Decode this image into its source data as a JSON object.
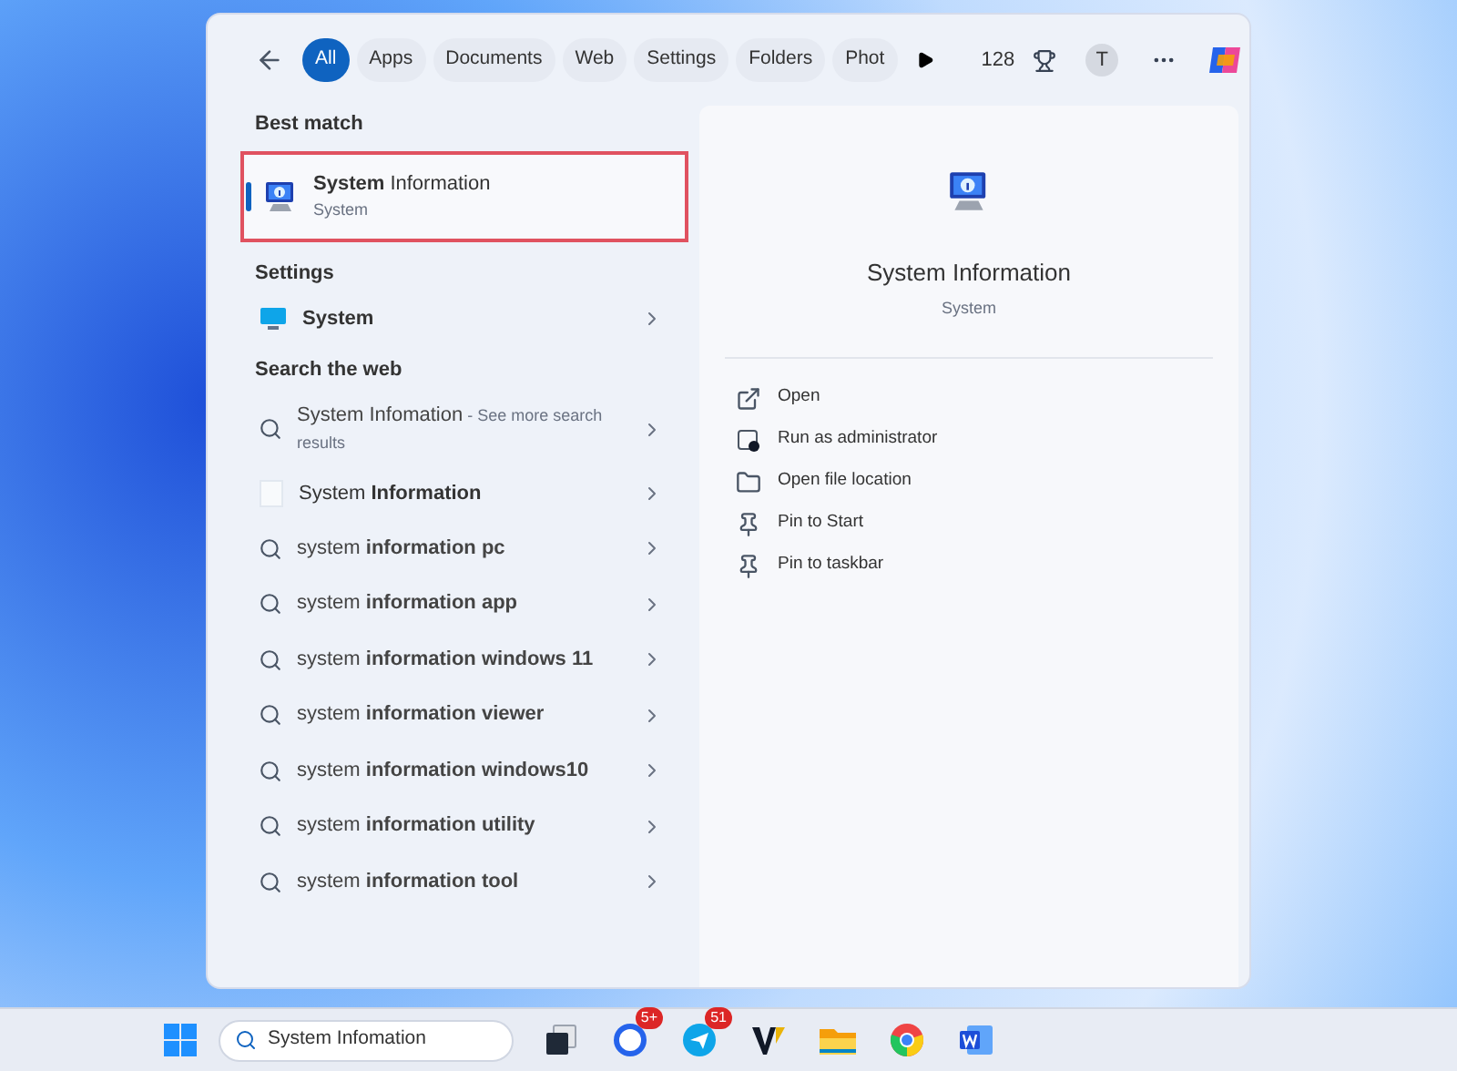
{
  "filters": [
    {
      "label": "All",
      "selected": true
    },
    {
      "label": "Apps",
      "selected": false
    },
    {
      "label": "Documents",
      "selected": false
    },
    {
      "label": "Web",
      "selected": false
    },
    {
      "label": "Settings",
      "selected": false
    },
    {
      "label": "Folders",
      "selected": false
    },
    {
      "label": "Phot",
      "selected": false
    }
  ],
  "points": "128",
  "avatar_letter": "T",
  "best_match": {
    "heading": "Best match",
    "title": "**System** Information",
    "subtitle": "System",
    "selected": true
  },
  "settings": {
    "heading": "Settings",
    "items": [
      {
        "label": "System"
      }
    ]
  },
  "web": {
    "heading": "Search the web",
    "items": [
      {
        "kind": "search",
        "text": "System Infomation",
        "hint": "- See more search results"
      },
      {
        "kind": "app",
        "text": "System **Information**"
      },
      {
        "kind": "search",
        "text": "system **information pc**"
      },
      {
        "kind": "search",
        "text": "system **information app**"
      },
      {
        "kind": "search",
        "text": "system **information windows 11**"
      },
      {
        "kind": "search",
        "text": "system **information viewer**"
      },
      {
        "kind": "search",
        "text": "system **information windows10**"
      },
      {
        "kind": "search",
        "text": "system **information utility**"
      },
      {
        "kind": "search",
        "text": "system **information tool**"
      }
    ]
  },
  "preview": {
    "title": "System Information",
    "subtitle": "System",
    "actions": [
      {
        "kind": "open",
        "label": "Open"
      },
      {
        "kind": "admin",
        "label": "Run as administrator"
      },
      {
        "kind": "folder",
        "label": "Open file location"
      },
      {
        "kind": "pin",
        "label": "Pin to Start"
      },
      {
        "kind": "pin",
        "label": "Pin to taskbar"
      }
    ]
  },
  "taskbar": {
    "search_value": "System Infomation",
    "apps": [
      {
        "kind": "taskview"
      },
      {
        "kind": "chat",
        "badge": "5+"
      },
      {
        "kind": "messenger",
        "badge": "51"
      },
      {
        "kind": "editor"
      },
      {
        "kind": "files"
      },
      {
        "kind": "browser"
      },
      {
        "kind": "word"
      }
    ]
  }
}
